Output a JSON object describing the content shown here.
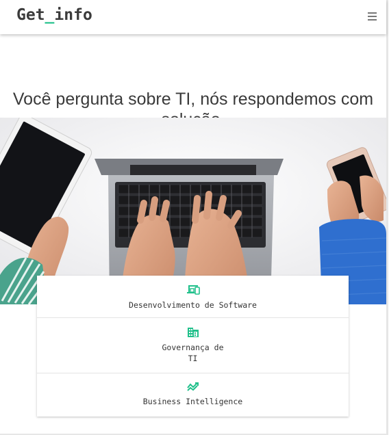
{
  "header": {
    "logo_prefix": "Get",
    "logo_underscore": "_",
    "logo_suffix": "info",
    "menu_icon": "hamburger-menu-icon"
  },
  "hero": {
    "headline": "Você pergunta sobre TI, nós respondemos com solução."
  },
  "services": [
    {
      "icon": "devices-icon",
      "label": "Desenvolvimento de Software"
    },
    {
      "icon": "business-building-icon",
      "label": "Governança de TI"
    },
    {
      "icon": "trending-chart-icon",
      "label": "Business Intelligence"
    }
  ],
  "colors": {
    "accent": "#21c08b",
    "text": "#3a3a3a",
    "header_bg": "#ffffff"
  }
}
